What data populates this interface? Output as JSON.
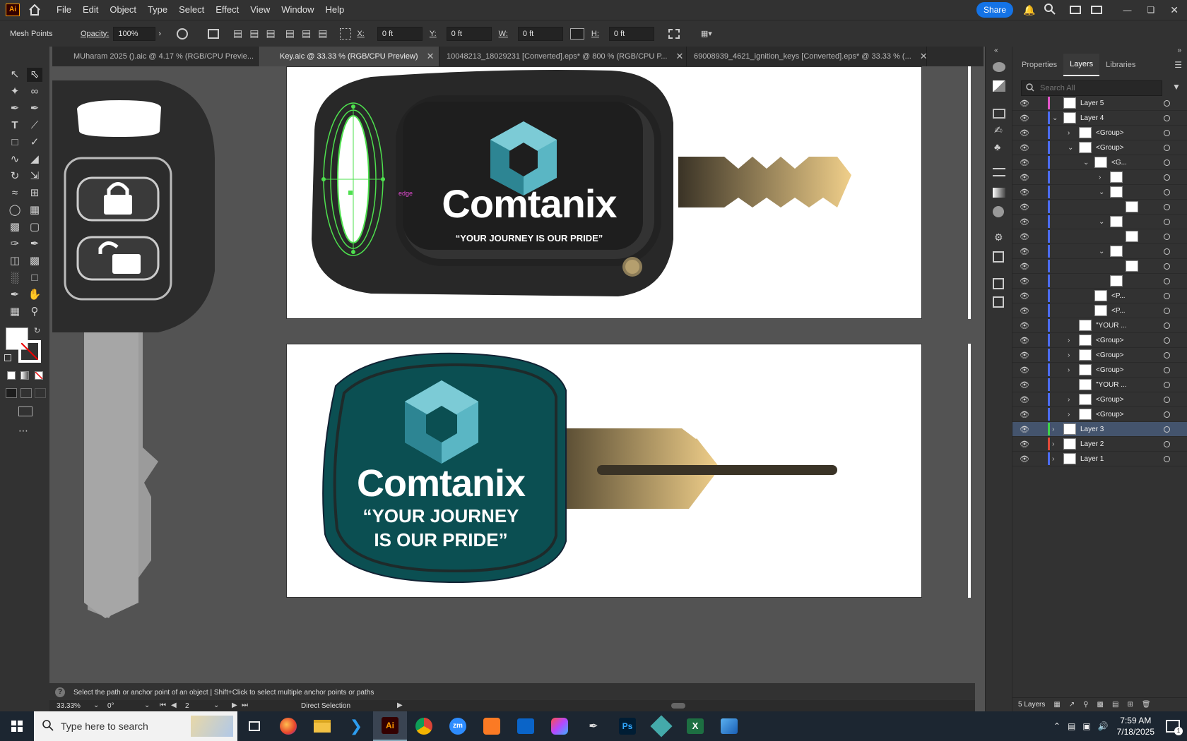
{
  "app": {
    "logo": "Ai",
    "home_icon": "home-icon"
  },
  "menu": [
    "File",
    "Edit",
    "Object",
    "Type",
    "Select",
    "Effect",
    "View",
    "Window",
    "Help"
  ],
  "share_label": "Share",
  "control": {
    "mode_label": "Mesh Points",
    "opacity_label": "Opacity:",
    "opacity_value": "100%",
    "x_label": "X:",
    "x_value": "0 ft",
    "y_label": "Y:",
    "y_value": "0 ft",
    "w_label": "W:",
    "w_value": "0 ft",
    "h_label": "H:",
    "h_value": "0 ft"
  },
  "tabs": [
    {
      "label": "MUharam 2025 ().aic @ 4.17 % (RGB/CPU Previe..."
    },
    {
      "label": "Key.aic @ 33.33 % (RGB/CPU Preview)"
    },
    {
      "label": "10048213_18029231 [Converted].eps* @ 800 % (RGB/CPU P..."
    },
    {
      "label": "69008939_4621_ignition_keys [Converted].eps* @ 33.33 % (..."
    }
  ],
  "artwork": {
    "brand": "Comtanix",
    "tagline_small": "“YOUR JOURNEY IS OUR PRIDE”",
    "tagline_line1": "“YOUR JOURNEY",
    "tagline_line2": "IS OUR PRIDE”",
    "anchor_label": "edge"
  },
  "colors": {
    "accent": "#1473e6",
    "teal": "#0b4f52",
    "cube_light": "#5ab6c4",
    "cube_dark": "#2d8593",
    "gold": "#f0cf8a"
  },
  "status": {
    "hint": "Select the path or anchor point of an object  |  Shift+Click to select multiple anchor points or paths",
    "zoom": "33.33%",
    "rotation": "0°",
    "artboard": "2",
    "tool": "Direct Selection"
  },
  "panel": {
    "tabs": [
      "Properties",
      "Layers",
      "Libraries"
    ],
    "search_placeholder": "Search All",
    "footer": "5 Layers",
    "rows": [
      {
        "label": "Layer 5",
        "color": "#e255c8",
        "caret": "",
        "indent": 0
      },
      {
        "label": "Layer 4",
        "color": "#4b6cf0",
        "caret": "v",
        "indent": 0
      },
      {
        "label": "<Group>",
        "color": "#4b6cf0",
        "caret": ">",
        "indent": 1
      },
      {
        "label": "<Group>",
        "color": "#4b6cf0",
        "caret": "v",
        "indent": 1
      },
      {
        "label": "<G...",
        "color": "#4b6cf0",
        "caret": "v",
        "indent": 2
      },
      {
        "label": "",
        "color": "#4b6cf0",
        "caret": ">",
        "indent": 3
      },
      {
        "label": "",
        "color": "#4b6cf0",
        "caret": "v",
        "indent": 3
      },
      {
        "label": "",
        "color": "#4b6cf0",
        "caret": "",
        "indent": 4
      },
      {
        "label": "",
        "color": "#4b6cf0",
        "caret": "v",
        "indent": 3
      },
      {
        "label": "",
        "color": "#4b6cf0",
        "caret": "",
        "indent": 4
      },
      {
        "label": "",
        "color": "#4b6cf0",
        "caret": "v",
        "indent": 3
      },
      {
        "label": "",
        "color": "#4b6cf0",
        "caret": "",
        "indent": 4
      },
      {
        "label": "",
        "color": "#4b6cf0",
        "caret": "",
        "indent": 3
      },
      {
        "label": "<P...",
        "color": "#4b6cf0",
        "caret": "",
        "indent": 2
      },
      {
        "label": "<P...",
        "color": "#4b6cf0",
        "caret": "",
        "indent": 2
      },
      {
        "label": "\"YOUR ...",
        "color": "#4b6cf0",
        "caret": "",
        "indent": 1
      },
      {
        "label": "<Group>",
        "color": "#4b6cf0",
        "caret": ">",
        "indent": 1
      },
      {
        "label": "<Group>",
        "color": "#4b6cf0",
        "caret": ">",
        "indent": 1
      },
      {
        "label": "<Group>",
        "color": "#4b6cf0",
        "caret": ">",
        "indent": 1
      },
      {
        "label": "\"YOUR ...",
        "color": "#4b6cf0",
        "caret": "",
        "indent": 1
      },
      {
        "label": "<Group>",
        "color": "#4b6cf0",
        "caret": ">",
        "indent": 1
      },
      {
        "label": "<Group>",
        "color": "#4b6cf0",
        "caret": ">",
        "indent": 1
      },
      {
        "label": "Layer 3",
        "color": "#3fd24a",
        "caret": ">",
        "indent": 0,
        "selected": true
      },
      {
        "label": "Layer 2",
        "color": "#e04a3a",
        "caret": ">",
        "indent": 0
      },
      {
        "label": "Layer 1",
        "color": "#4b6cf0",
        "caret": ">",
        "indent": 0
      }
    ]
  },
  "taskbar": {
    "search_placeholder": "Type here to search",
    "apps": [
      "firefox-icon",
      "file-explorer-icon",
      "vscode-icon",
      "illustrator-icon",
      "chrome-icon",
      "zoom-icon",
      "xampp-icon",
      "outlook-icon",
      "creative-cloud-icon",
      "pen-icon",
      "photoshop-icon",
      "app-icon",
      "excel-icon",
      "photos-icon"
    ],
    "app_labels": {
      "illustrator": "Ai",
      "zoom": "zm",
      "photoshop": "Ps",
      "excel": "X"
    },
    "time": "7:59 AM",
    "date": "7/18/2025",
    "notifications": "1"
  }
}
